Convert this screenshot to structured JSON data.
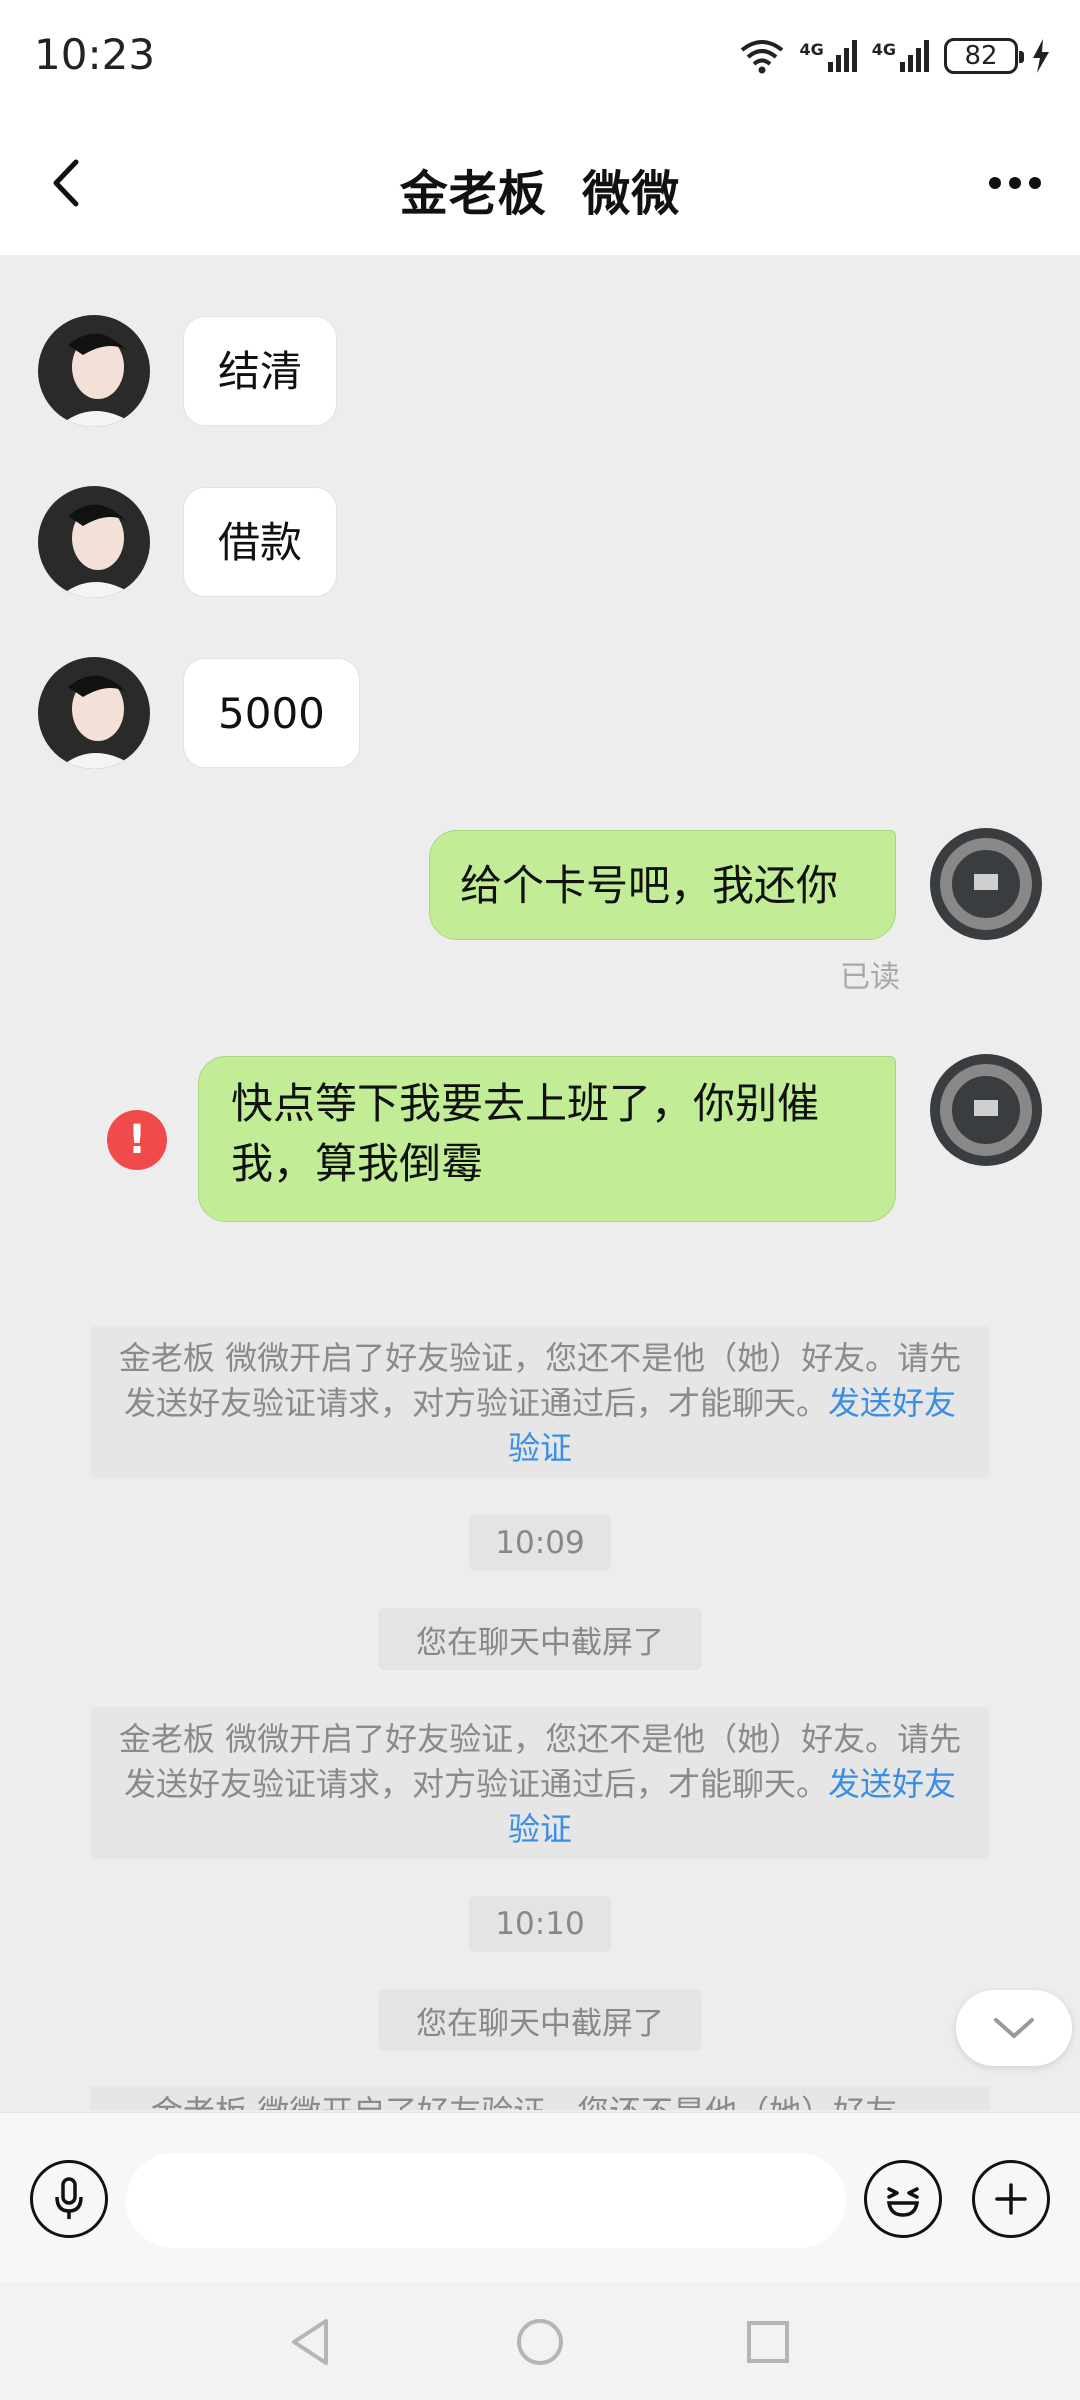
{
  "status_bar": {
    "time": "10:23",
    "network_1": "4G",
    "network_2": "4G",
    "battery": "82"
  },
  "header": {
    "title": "金老板  微微"
  },
  "messages": {
    "m1": "结清",
    "m2": "借款",
    "m3": "5000",
    "m4": "给个卡号吧，我还你",
    "read_receipt": "已读",
    "m5": "快点等下我要去上班了，你别催我，算我倒霉"
  },
  "notices": {
    "verify_text": "金老板  微微开启了好友验证，您还不是他（她）好友。请先发送好友验证请求，对方验证通过后，才能聊天。",
    "verify_link": "发送好友验证",
    "time_1": "10:09",
    "screenshot_1": "您在聊天中截屏了",
    "time_2": "10:10",
    "screenshot_2": "您在聊天中截屏了",
    "clipped": "金老板  微微开启了好友验证，您还不是他（她）好友。"
  },
  "input": {
    "placeholder": ""
  },
  "icons": {
    "back": "chevron-left-icon",
    "more": "ellipsis-icon",
    "voice": "microphone-icon",
    "emoji": "smiley-icon",
    "plus": "plus-icon",
    "error": "exclamation-icon"
  },
  "colors": {
    "sent_bubble": "#c2ed96",
    "link": "#3a8ee6",
    "error": "#f04a4a"
  }
}
